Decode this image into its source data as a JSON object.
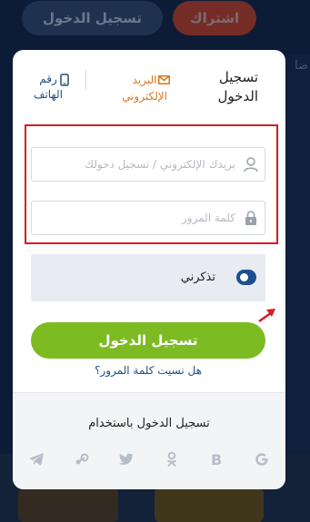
{
  "background": {
    "register_label": "اشتراك",
    "login_label": "تسجيل الدخول",
    "side_text": "ضا"
  },
  "modal": {
    "title": "تسجيل الدخول",
    "tab_email_label": "البريد الإلكتروني",
    "tab_phone_label": "رقم الهاتف",
    "username_placeholder": "بريدك الإلكتروني / تسجيل دخولك",
    "password_placeholder": "كلمة المرور",
    "remember_label": "تذكرني",
    "login_button": "تسجيل الدخول",
    "forgot_link": "هل نسيت كلمة المرور؟",
    "social_title": "تسجيل الدخول باستخدام"
  },
  "social_icons": [
    "google-icon",
    "bold-b-icon",
    "odnoklassniki-icon",
    "twitter-icon",
    "steam-icon",
    "telegram-icon"
  ],
  "colors": {
    "accent_orange": "#d9771f",
    "primary_blue": "#1e4e86",
    "button_green": "#7dbb22",
    "highlight_red": "#d81b22"
  }
}
